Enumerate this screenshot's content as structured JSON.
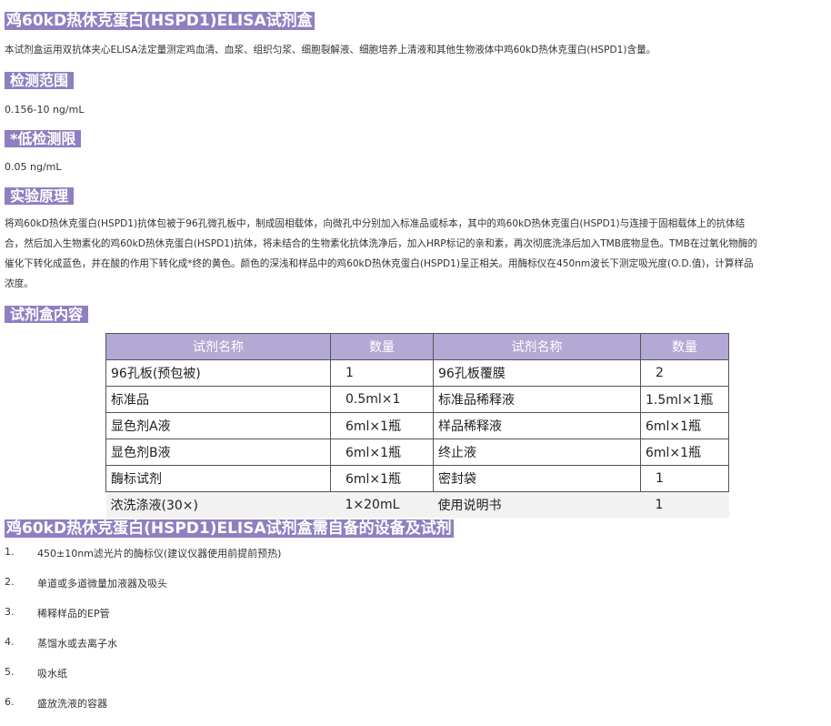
{
  "title": "鸡60kD热休克蛋白(HSPD1)ELISA试剂盒",
  "intro": "本试剂盒运用双抗体夹心ELISA法定量测定鸡血清、血浆、组织匀浆、细胞裂解液、细胞培养上清液和其他生物液体中鸡60kD热休克蛋白(HSPD1)含量。",
  "sections": {
    "range": {
      "heading": "检测范围",
      "value": "0.156-10 ng/mL"
    },
    "lod": {
      "heading": "*低检测限",
      "value": "0.05 ng/mL"
    },
    "principle": {
      "heading": "实验原理",
      "lines": [
        "将鸡60kD热休克蛋白(HSPD1)抗体包被于96孔微孔板中，制成固相载体，向微孔中分别加入标准品或标本，其中的鸡60kD热休克蛋白(HSPD1)与连接于固相载体上的抗体结",
        "合，然后加入生物素化的鸡60kD热休克蛋白(HSPD1)抗体，将未结合的生物素化抗体洗净后，加入HRP标记的亲和素，再次彻底洗涤后加入TMB底物显色。TMB在过氧化物酶的",
        "催化下转化成蓝色，并在酸的作用下转化成*终的黄色。颜色的深浅和样品中的鸡60kD热休克蛋白(HSPD1)呈正相关。用酶标仪在450nm波长下测定吸光度(O.D.值)，计算样品",
        "浓度。"
      ]
    },
    "kit": {
      "heading": "试剂盒内容",
      "headers": [
        "试剂名称",
        "数量",
        "试剂名称",
        "数量"
      ],
      "rows": [
        [
          "96孔板(预包被)",
          "1",
          "96孔板覆膜",
          "2"
        ],
        [
          "标准品",
          "0.5ml×1",
          "标准品稀释液",
          "1.5ml×1瓶"
        ],
        [
          "显色剂A液",
          "6ml×1瓶",
          "样品稀释液",
          "6ml×1瓶"
        ],
        [
          "显色剂B液",
          "6ml×1瓶",
          "终止液",
          "6ml×1瓶"
        ],
        [
          "酶标试剂",
          "6ml×1瓶",
          "密封袋",
          "1"
        ],
        [
          "浓洗涤液(30×)",
          "1×20mL",
          "使用说明书",
          "1"
        ]
      ]
    },
    "equipment": {
      "heading": "鸡60kD热休克蛋白(HSPD1)ELISA试剂盒需自备的设备及试剂",
      "items": [
        {
          "num": "1.",
          "text": "450±10nm滤光片的酶标仪(建议仪器使用前提前预热)"
        },
        {
          "num": "2.",
          "text": "单道或多道微量加液器及吸头"
        },
        {
          "num": "3.",
          "text": "稀释样品的EP管"
        },
        {
          "num": "4.",
          "text": "蒸馏水或去离子水"
        },
        {
          "num": "5.",
          "text": "吸水纸"
        },
        {
          "num": "6.",
          "text": "盛放洗液的容器"
        }
      ]
    }
  },
  "colors": {
    "highlight": "#8f7fc1",
    "table_header": "#b4a8d4"
  }
}
